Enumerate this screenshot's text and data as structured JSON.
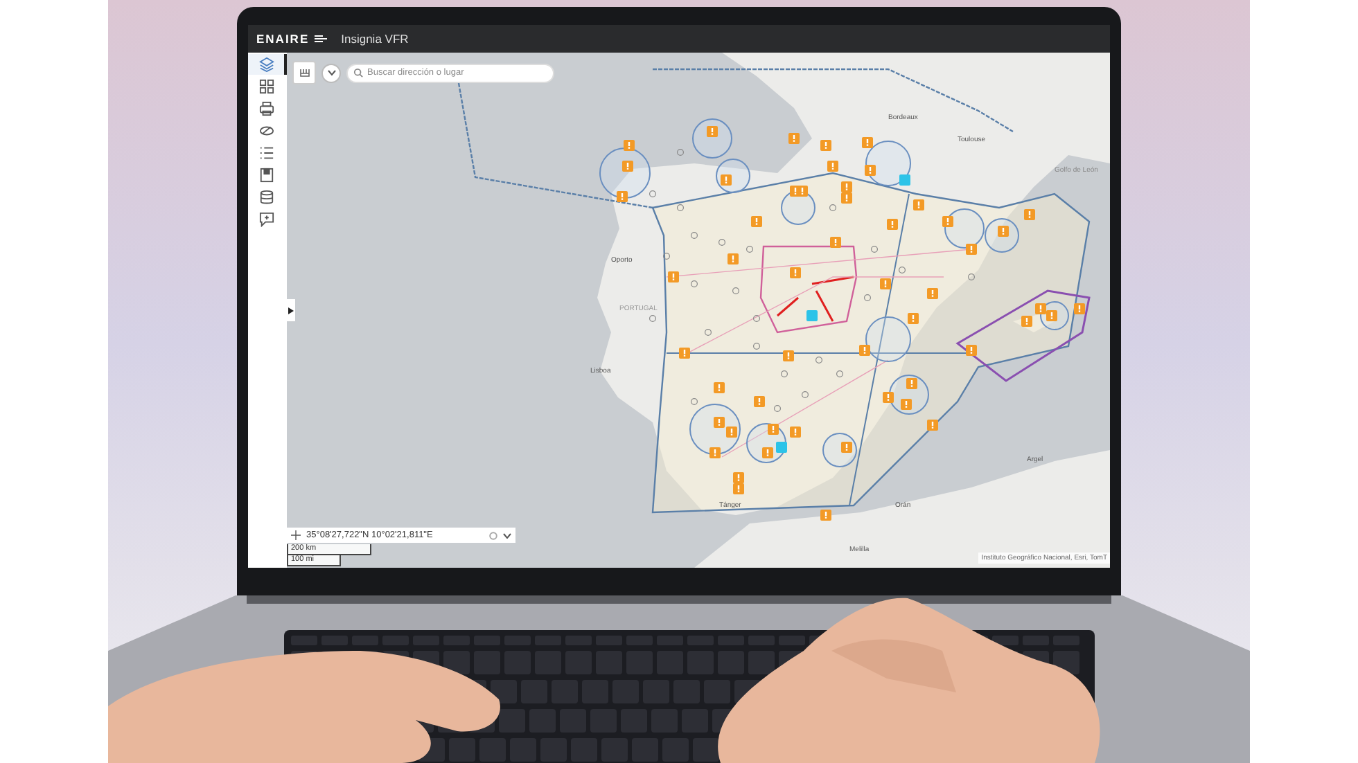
{
  "app": {
    "logo": "ENAIRE",
    "title": "Insignia VFR"
  },
  "sidebar": {
    "items": [
      {
        "kind": "layers",
        "selected": true
      },
      {
        "kind": "grid",
        "selected": false
      },
      {
        "kind": "print",
        "selected": false
      },
      {
        "kind": "measure",
        "selected": false
      },
      {
        "kind": "legend",
        "selected": false
      },
      {
        "kind": "bookmark",
        "selected": false
      },
      {
        "kind": "database",
        "selected": false
      },
      {
        "kind": "comment",
        "selected": false
      }
    ]
  },
  "search": {
    "placeholder": "Buscar dirección o lugar"
  },
  "map": {
    "labels": [
      {
        "text": "Bordeaux"
      },
      {
        "text": "Toulouse"
      },
      {
        "text": "Golfo de León"
      },
      {
        "text": "Oporto"
      },
      {
        "text": "PORTUGAL"
      },
      {
        "text": "Lisboa"
      },
      {
        "text": "Tánger"
      },
      {
        "text": "Orán"
      },
      {
        "text": "Argel"
      },
      {
        "text": "Melilla"
      }
    ]
  },
  "coordinates": {
    "value": "35°08'27,722\"N 10°02'21,811\"E"
  },
  "scale": [
    "200 km",
    "100 mi"
  ],
  "attribution": "Instituto Geográfico Nacional, Esri, TomT"
}
